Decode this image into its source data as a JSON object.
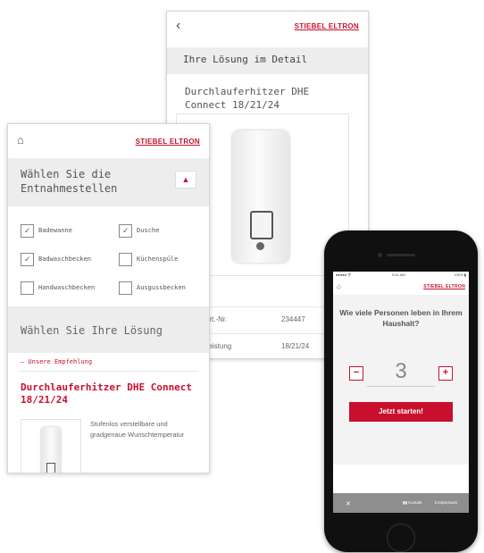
{
  "brand": {
    "logo_text": "STIEBEL ELTRON",
    "accent_color": "#c8102e"
  },
  "detail_screen": {
    "back_icon": "chevron-left-icon",
    "header": "Ihre Lösung im Detail",
    "product_name": "Durchlauferhitzer DHE Connect 18/21/24",
    "rows": [
      {
        "label": "Art.-Nr.",
        "value": "234447"
      },
      {
        "label": "Leistung",
        "value": "18/21/24"
      }
    ]
  },
  "selection_screen": {
    "home_icon": "home-icon",
    "heading": "Wählen Sie die Entnahmestellen",
    "dropdown_icon": "chevron-down-icon",
    "options": [
      {
        "label": "Badewanne",
        "checked": true
      },
      {
        "label": "Dusche",
        "checked": true
      },
      {
        "label": "Badwaschbecken",
        "checked": true
      },
      {
        "label": "Küchenspüle",
        "checked": false
      },
      {
        "label": "Handwaschbecken",
        "checked": false
      },
      {
        "label": "Ausgussbecken",
        "checked": false
      }
    ],
    "solution_heading": "Wählen Sie Ihre Lösung",
    "recommendation": "– Unsere Empfehlung",
    "product_name": "Durchlauferhitzer DHE Connect 18/21/24",
    "product_desc": "Stufenlos verstellbare und gradgenaue Wunschtemperatur"
  },
  "phone_screen": {
    "status_left": "●●●●● 令",
    "status_time": "9:41 AM",
    "status_right": "100% ▮",
    "home_icon": "home-icon",
    "question": "Wie viele Personen leben in Ihrem Haushalt?",
    "minus_label": "−",
    "count": "3",
    "plus_label": "+",
    "start_button": "Jetzt starten!",
    "footer_left": "✕",
    "footer_mid": "▮▮ Kontakt",
    "footer_right": "ℹ Impressum"
  }
}
